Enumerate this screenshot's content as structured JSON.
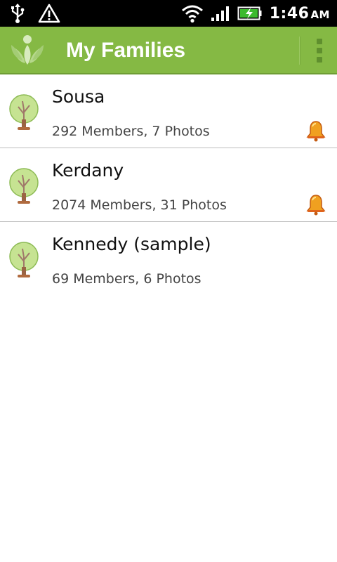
{
  "status_bar": {
    "time": "1:46",
    "ampm": "AM",
    "icons": [
      "usb-icon",
      "warning-icon",
      "wifi-icon",
      "signal-icon",
      "battery-charging-icon"
    ]
  },
  "action_bar": {
    "title": "My Families",
    "logo_icon": "app-logo-icon",
    "overflow_icon": "overflow-menu-icon",
    "color": "#85b944"
  },
  "families": [
    {
      "name": "Sousa",
      "meta": "292 Members, 7 Photos",
      "notification": true
    },
    {
      "name": "Kerdany",
      "meta": "2074 Members, 31 Photos",
      "notification": true
    },
    {
      "name": "Kennedy (sample)",
      "meta": "69 Members, 6 Photos",
      "notification": false
    }
  ]
}
